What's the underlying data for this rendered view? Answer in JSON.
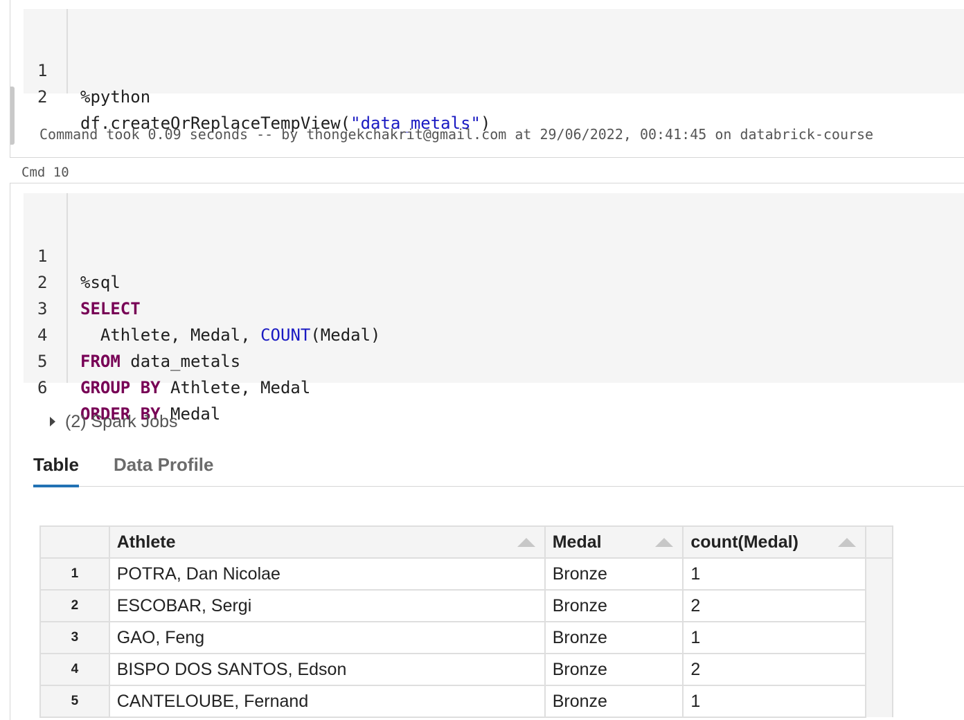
{
  "cell1": {
    "lines": [
      {
        "num": "1",
        "text": "%python"
      },
      {
        "num": "2",
        "prefix": "df.createOrReplaceTempView(",
        "string": "\"data_metals\"",
        "suffix": ")"
      }
    ],
    "command_took": "Command took 0.09 seconds -- by thongekchakrit@gmail.com at 29/06/2022, 00:41:45 on databrick-course"
  },
  "cmd_label": "Cmd 10",
  "cell2": {
    "lines": [
      {
        "num": "1",
        "text": "%sql"
      },
      {
        "num": "2",
        "kw": "SELECT"
      },
      {
        "num": "3",
        "pre": "  Athlete, Medal, ",
        "fn": "COUNT",
        "post": "(Medal)"
      },
      {
        "num": "4",
        "kw": "FROM",
        "rest": " data_metals"
      },
      {
        "num": "5",
        "kw": "GROUP BY",
        "rest": " Athlete, Medal"
      },
      {
        "num": "6",
        "kw": "ORDER BY",
        "rest": " Medal"
      }
    ],
    "spark_jobs": "(2) Spark Jobs",
    "tabs": {
      "table": "Table",
      "profile": "Data Profile",
      "active": "Table"
    },
    "table": {
      "columns": [
        "Athlete",
        "Medal",
        "count(Medal)"
      ],
      "rows": [
        {
          "idx": "1",
          "athlete": "POTRA, Dan Nicolae",
          "medal": "Bronze",
          "count": "1"
        },
        {
          "idx": "2",
          "athlete": "ESCOBAR, Sergi",
          "medal": "Bronze",
          "count": "2"
        },
        {
          "idx": "3",
          "athlete": "GAO, Feng",
          "medal": "Bronze",
          "count": "1"
        },
        {
          "idx": "4",
          "athlete": "BISPO DOS SANTOS, Edson",
          "medal": "Bronze",
          "count": "2"
        },
        {
          "idx": "5",
          "athlete": "CANTELOUBE, Fernand",
          "medal": "Bronze",
          "count": "1"
        }
      ]
    }
  },
  "colors": {
    "keyword": "#770055",
    "function": "#1a1ac2",
    "tab_accent": "#2272b4"
  }
}
